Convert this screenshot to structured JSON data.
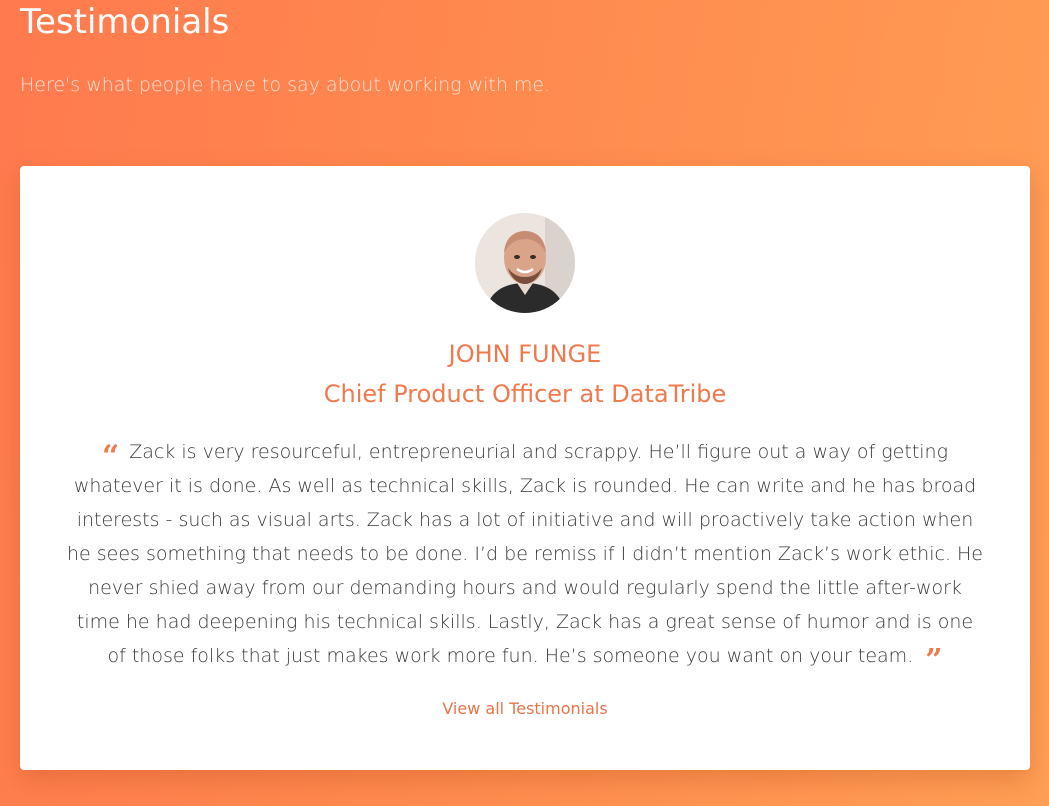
{
  "section": {
    "title": "Testimonials",
    "subtitle": "Here's what people have to say about working with me."
  },
  "testimonial": {
    "name": "JOHN FUNGE",
    "role": "Chief Product Officer at DataTribe",
    "quote": "Zack is very resourceful, entrepreneurial and scrappy. He’ll figure out a way of getting whatever it is done. As well as technical skills, Zack is rounded. He can write and he has broad interests - such as visual arts. Zack has a lot of initiative and will proactively take action when he sees something that needs to be done. I’d be remiss if I didn’t mention Zack’s work ethic. He never shied away from our demanding hours and would regularly spend the little after-work time he had deepening his technical skills. Lastly, Zack has a great sense of humor and is one of those folks that just makes work more fun. He’s someone you want on your team.",
    "open_quote_glyph": "“",
    "close_quote_glyph": "”",
    "avatar_icon": "avatar-photo"
  },
  "links": {
    "view_all": "View all Testimonials"
  },
  "colors": {
    "accent": "#f07a4e",
    "background_start": "#ff7a4f",
    "background_end": "#ff9f55",
    "card": "#ffffff",
    "body_text": "#3a3a3a"
  }
}
